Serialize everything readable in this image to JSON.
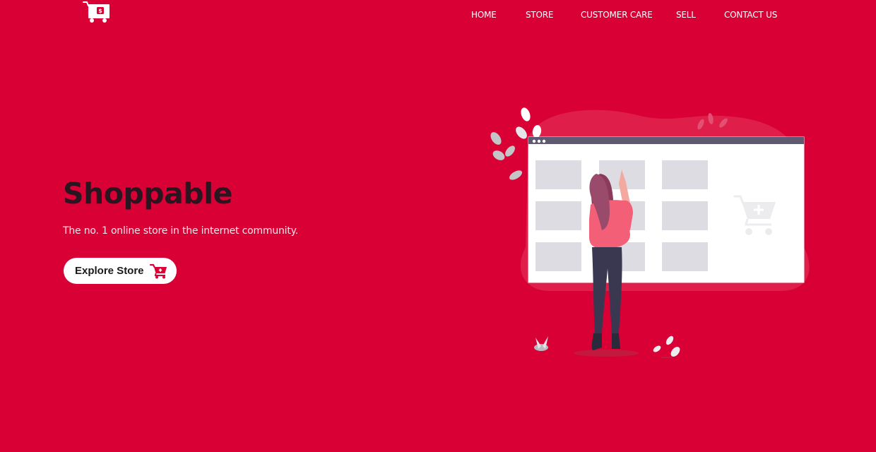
{
  "brand": {
    "logo_icon": "shopping-cart-logo-icon",
    "logo_badge": "$"
  },
  "nav": {
    "items": [
      {
        "label": "HOME"
      },
      {
        "label": "STORE"
      },
      {
        "label": "CUSTOMER CARE"
      },
      {
        "label": "SELL"
      },
      {
        "label": "CONTACT US"
      }
    ]
  },
  "hero": {
    "title": "Shoppable",
    "subtitle": "The no. 1 online store in the internet community.",
    "cta_label": "Explore Store",
    "cta_icon": "add-to-cart-icon",
    "illustration": "woman-browsing-online-store-illustration"
  },
  "colors": {
    "background": "#d90036",
    "title": "#2a1520",
    "button_bg": "#ffffff",
    "accent": "#d90036"
  }
}
